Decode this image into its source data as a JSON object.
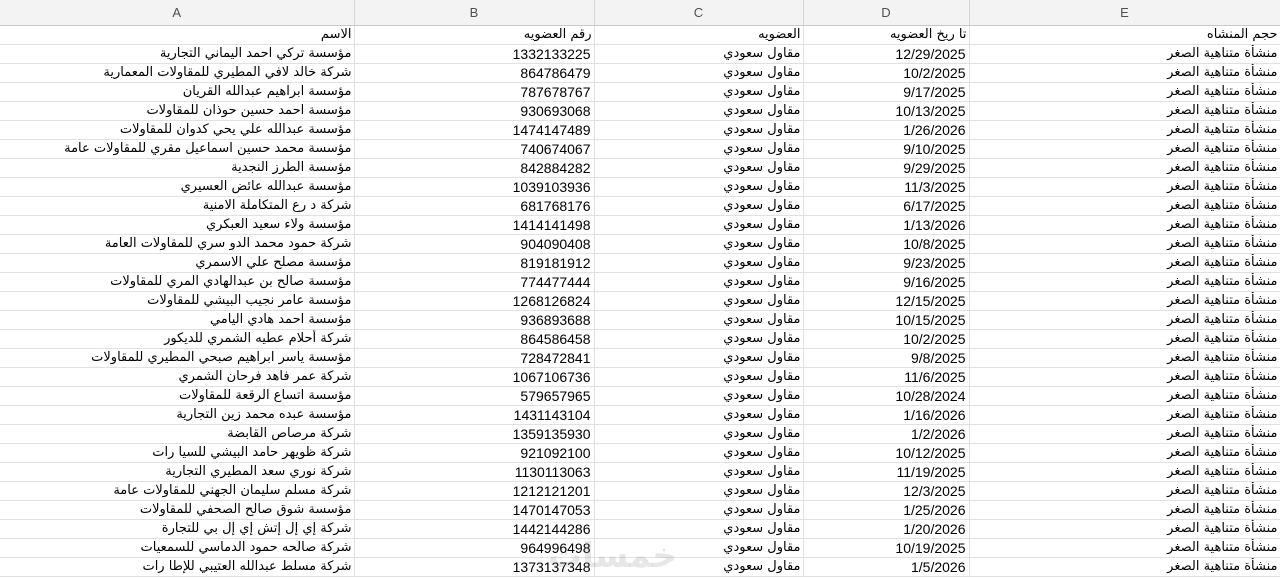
{
  "columns": [
    "A",
    "B",
    "C",
    "D",
    "E"
  ],
  "header_row": {
    "name": "الاسم",
    "membership_no": "رقم العضويه",
    "membership": "العضويه",
    "membership_date": "تا ريخ العضويه",
    "size": "حجم المنشاه"
  },
  "rows": [
    {
      "name": "مؤسسة تركي احمد اليماني التجارية",
      "number": "1332133225",
      "membership": "مقاول سعودي",
      "date": "12/29/2025",
      "size": "منشأة متناهية الصغر"
    },
    {
      "name": "شركة خالد لافي المطيري للمقاولات المعمارية",
      "number": "864786479",
      "membership": "مقاول سعودي",
      "date": "10/2/2025",
      "size": "منشأة متناهية الصغر"
    },
    {
      "name": "مؤسسة ابراهيم عبدالله القريان",
      "number": "787678767",
      "membership": "مقاول سعودي",
      "date": "9/17/2025",
      "size": "منشأة متناهية الصغر"
    },
    {
      "name": "مؤسسة احمد حسين حوذان للمقاولات",
      "number": "930693068",
      "membership": "مقاول سعودي",
      "date": "10/13/2025",
      "size": "منشأة متناهية الصغر"
    },
    {
      "name": "مؤسسة عبدالله علي يحي كدوان للمقاولات",
      "number": "1474147489",
      "membership": "مقاول سعودي",
      "date": "1/26/2026",
      "size": "منشأة متناهية الصغر"
    },
    {
      "name": "مؤسسة محمد حسين اسماعيل مقري للمقاولات عامة",
      "number": "740674067",
      "membership": "مقاول سعودي",
      "date": "9/10/2025",
      "size": "منشأة متناهية الصغر"
    },
    {
      "name": "مؤسسة الطرز النجدية",
      "number": "842884282",
      "membership": "مقاول سعودي",
      "date": "9/29/2025",
      "size": "منشأة متناهية الصغر"
    },
    {
      "name": "مؤسسة عبدالله عائض العسيري",
      "number": "1039103936",
      "membership": "مقاول سعودي",
      "date": "11/3/2025",
      "size": "منشأة متناهية الصغر"
    },
    {
      "name": "شركة د رع المتكاملة الامنية",
      "number": "681768176",
      "membership": "مقاول سعودي",
      "date": "6/17/2025",
      "size": "منشأة متناهية الصغر"
    },
    {
      "name": "مؤسسة ولاء سعيد العبكري",
      "number": "1414141498",
      "membership": "مقاول سعودي",
      "date": "1/13/2026",
      "size": "منشأة متناهية الصغر"
    },
    {
      "name": "شركة حمود محمد الدو سري للمقاولات العامة",
      "number": "904090408",
      "membership": "مقاول سعودي",
      "date": "10/8/2025",
      "size": "منشأة متناهية الصغر"
    },
    {
      "name": "مؤسسة مصلح علي الاسمري",
      "number": "819181912",
      "membership": "مقاول سعودي",
      "date": "9/23/2025",
      "size": "منشأة متناهية الصغر"
    },
    {
      "name": "مؤسسة صالح بن عبدالهادي المري للمقاولات",
      "number": "774477444",
      "membership": "مقاول سعودي",
      "date": "9/16/2025",
      "size": "منشأة متناهية الصغر"
    },
    {
      "name": "مؤسسة عامر نجيب البيشي للمقاولات",
      "number": "1268126824",
      "membership": "مقاول سعودي",
      "date": "12/15/2025",
      "size": "منشأة متناهية الصغر"
    },
    {
      "name": "مؤسسة احمد هادي اليامي",
      "number": "936893688",
      "membership": "مقاول سعودي",
      "date": "10/15/2025",
      "size": "منشأة متناهية الصغر"
    },
    {
      "name": "شركة أحلام عطيه الشمري للديكور",
      "number": "864586458",
      "membership": "مقاول سعودي",
      "date": "10/2/2025",
      "size": "منشأة متناهية الصغر"
    },
    {
      "name": "مؤسسة ياسر ابراهيم صبحي المطيري للمقاولات",
      "number": "728472841",
      "membership": "مقاول سعودي",
      "date": "9/8/2025",
      "size": "منشأة متناهية الصغر"
    },
    {
      "name": "شركة عمر فاهد فرحان الشمري",
      "number": "1067106736",
      "membership": "مقاول سعودي",
      "date": "11/6/2025",
      "size": "منشأة متناهية الصغر"
    },
    {
      "name": "مؤسسة اتساع الرقعة للمقاولات",
      "number": "579657965",
      "membership": "مقاول سعودي",
      "date": "10/28/2024",
      "size": "منشأة متناهية الصغر"
    },
    {
      "name": "مؤسسة عبده محمد  زين التجارية",
      "number": "1431143104",
      "membership": "مقاول سعودي",
      "date": "1/16/2026",
      "size": "منشأة متناهية الصغر"
    },
    {
      "name": "شركة مرصاص القابضة",
      "number": "1359135930",
      "membership": "مقاول سعودي",
      "date": "1/2/2026",
      "size": "منشأة متناهية الصغر"
    },
    {
      "name": "شركة ظويهر حامد البيشي للسيا رات",
      "number": "921092100",
      "membership": "مقاول سعودي",
      "date": "10/12/2025",
      "size": "منشأة متناهية الصغر"
    },
    {
      "name": "شركة نوري سعد المطيري التجارية",
      "number": "1130113063",
      "membership": "مقاول سعودي",
      "date": "11/19/2025",
      "size": "منشأة متناهية الصغر"
    },
    {
      "name": "شركة مسلم سليمان الجهني للمقاولات عامة",
      "number": "1212121201",
      "membership": "مقاول سعودي",
      "date": "12/3/2025",
      "size": "منشأة متناهية الصغر"
    },
    {
      "name": "مؤسسة شوق صالح الصحفي للمقاولات",
      "number": "1470147053",
      "membership": "مقاول سعودي",
      "date": "1/25/2026",
      "size": "منشأة متناهية الصغر"
    },
    {
      "name": "شركة إي إل إتش إي إل بي للتجارة",
      "number": "1442144286",
      "membership": "مقاول سعودي",
      "date": "1/20/2026",
      "size": "منشأة متناهية الصغر"
    },
    {
      "name": "شركة صالحه حمود الدماسي للسمعيات",
      "number": "964996498",
      "membership": "مقاول سعودي",
      "date": "10/19/2025",
      "size": "منشأة متناهية الصغر"
    },
    {
      "name": "شركة مسلط عبدالله العتيبي للإطا رات",
      "number": "1373137348",
      "membership": "مقاول سعودي",
      "date": "1/5/2026",
      "size": "منشأة متناهية الصغر"
    }
  ],
  "watermark": "خمسات"
}
